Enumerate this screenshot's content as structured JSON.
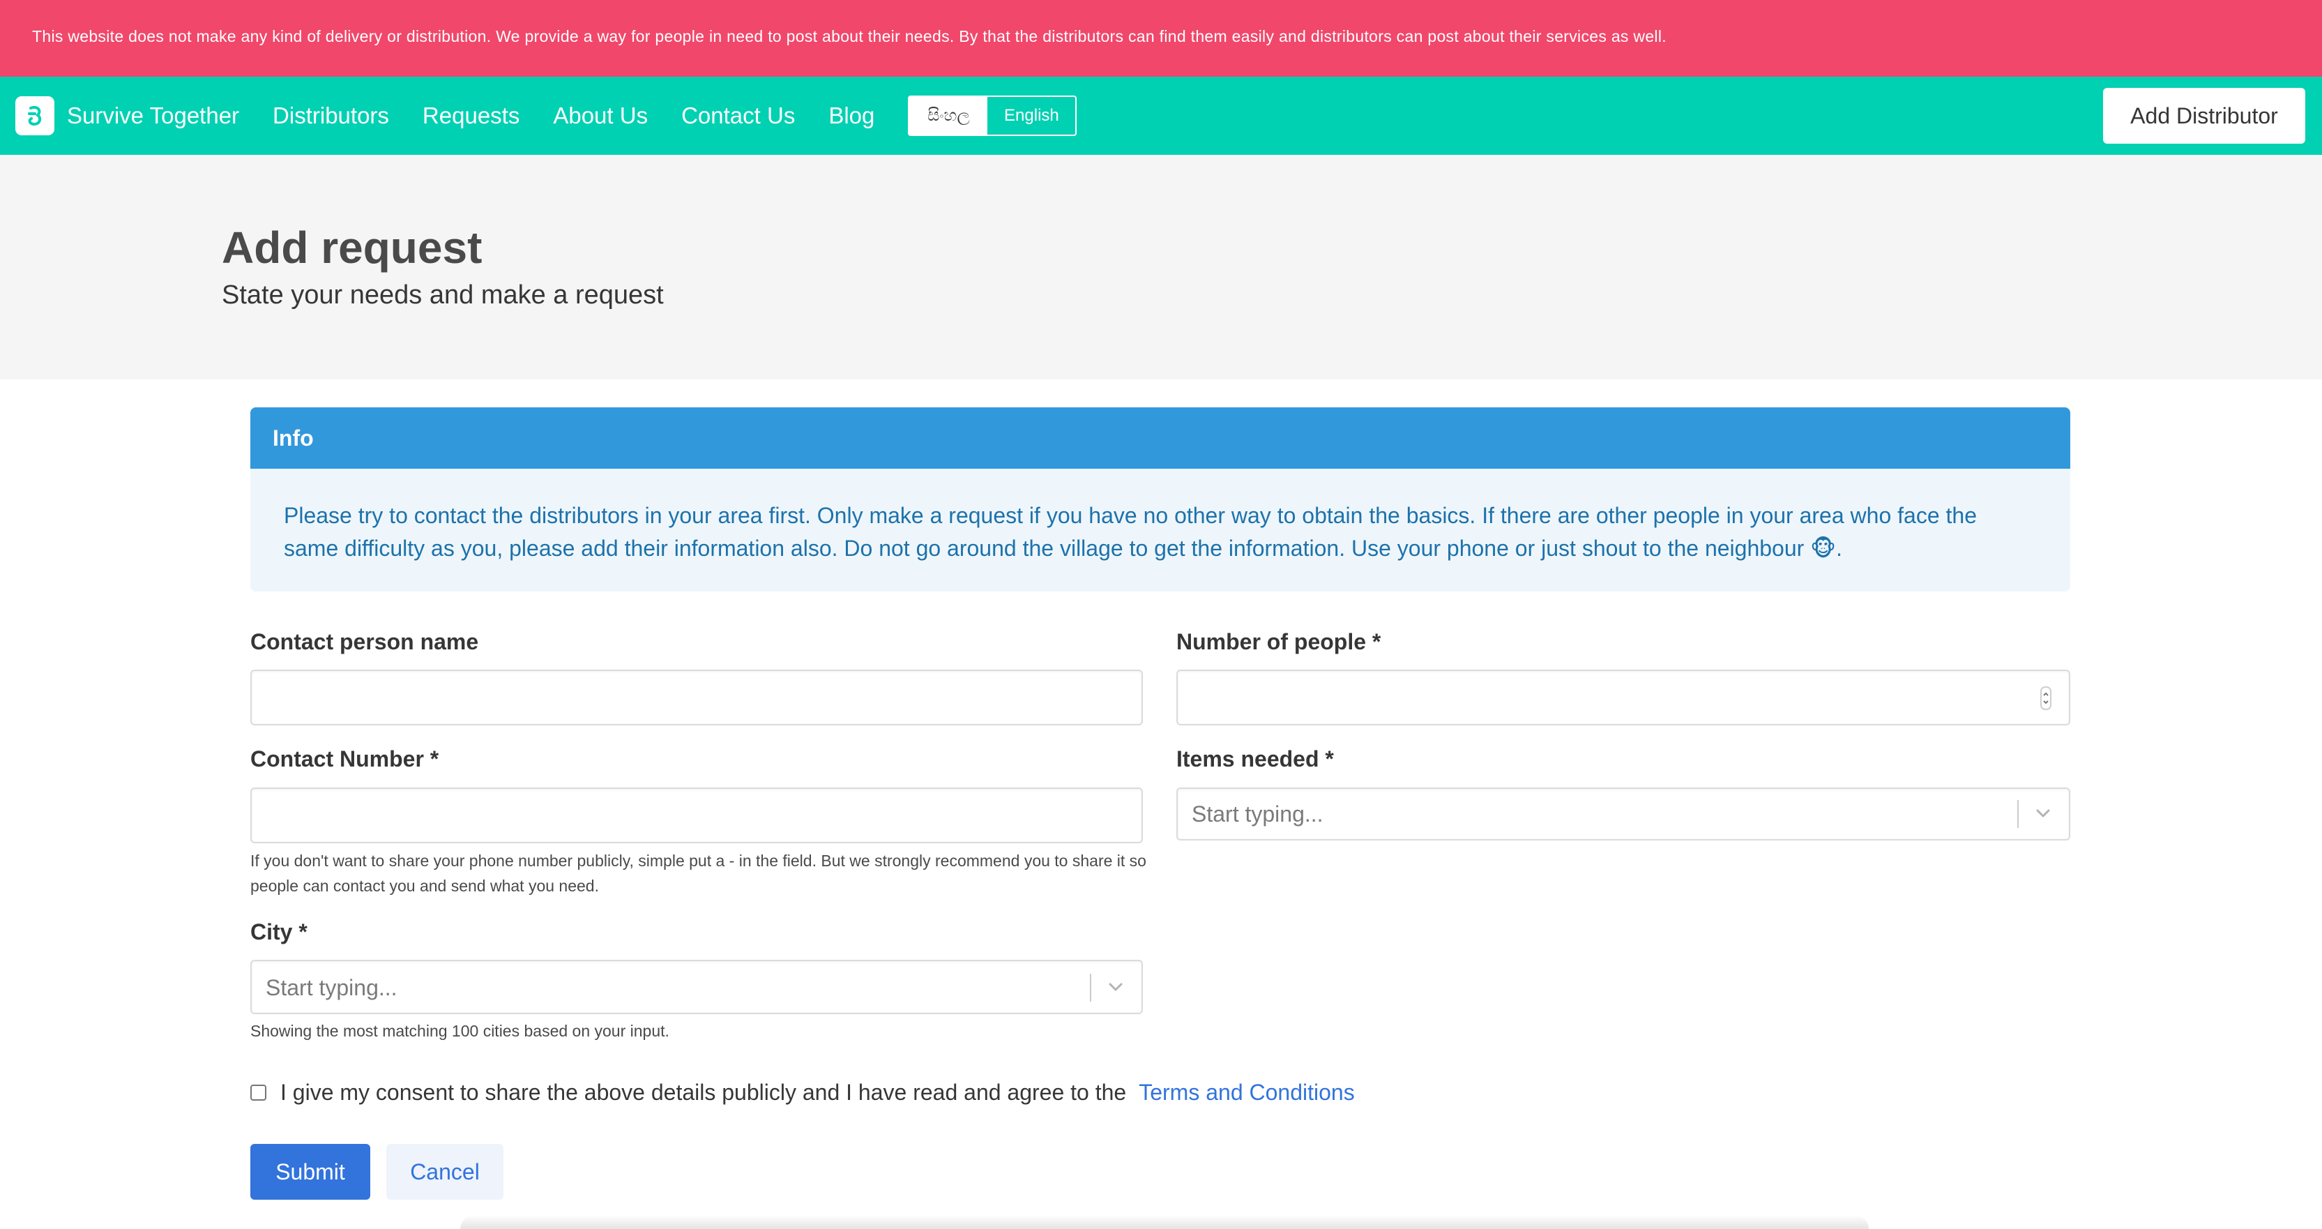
{
  "notice": "This website does not make any kind of delivery or distribution. We provide a way for people in need to post about their needs. By that the distributors can find them easily and distributors can post about their services as well.",
  "nav": {
    "brand": "Survive Together",
    "items": [
      "Distributors",
      "Requests",
      "About Us",
      "Contact Us",
      "Blog"
    ],
    "lang_sinhala": "සිංහල",
    "lang_english": "English",
    "add_distributor": "Add Distributor"
  },
  "hero": {
    "title": "Add request",
    "subtitle": "State your needs and make a request"
  },
  "info": {
    "header": "Info",
    "body": "Please try to contact the distributors in your area first. Only make a request if you have no other way to obtain the basics. If there are other people in your area who face the same difficulty as you, please add their information also. Do not go around the village to get the information. Use your phone or just shout to the neighbour 🐵."
  },
  "form": {
    "contact_name_label": "Contact person name",
    "contact_name_value": "",
    "people_label": "Number of people *",
    "people_value": "",
    "contact_number_label": "Contact Number *",
    "contact_number_value": "",
    "contact_number_help": "If you don't want to share your phone number publicly, simple put a - in the field. But we strongly recommend you to share it so people can contact you and send what you need.",
    "items_label": "Items needed *",
    "items_placeholder": "Start typing...",
    "city_label": "City *",
    "city_placeholder": "Start typing...",
    "city_help": "Showing the most matching 100 cities based on your input.",
    "consent_text": "I give my consent to share the above details publicly and I have read and agree to the",
    "terms_link": "Terms and Conditions",
    "consent_checked": false,
    "submit": "Submit",
    "cancel": "Cancel"
  },
  "colors": {
    "notice_bg": "#f1476b",
    "navbar_bg": "#00d1b2",
    "info_header_bg": "#3298dc",
    "info_body_bg": "#eef6fc",
    "primary": "#3273dc"
  },
  "icons": [
    "logo-icon",
    "chevron-down-icon",
    "spinner-icon"
  ]
}
